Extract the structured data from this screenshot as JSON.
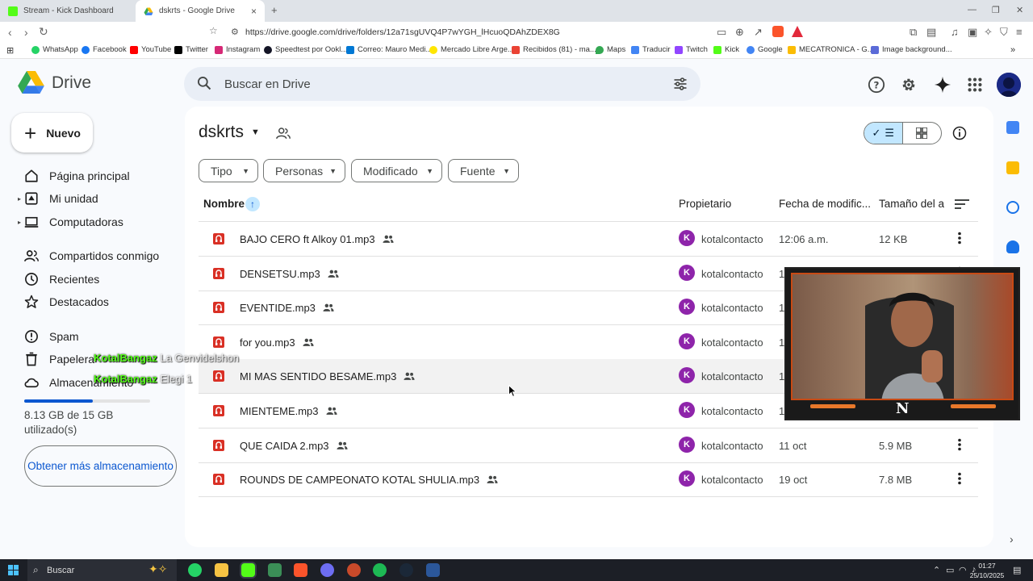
{
  "browser": {
    "tabs": [
      {
        "title": "Stream - Kick Dashboard",
        "active": false
      },
      {
        "title": "dskrts - Google Drive",
        "active": true
      }
    ],
    "url": "https://drive.google.com/drive/folders/12a71sgUVQ4P7wYGH_lHcuoQDAhZDEX8G",
    "bookmarks": [
      "WhatsApp",
      "Facebook",
      "YouTube",
      "Twitter",
      "Instagram",
      "Speedtest por Ookl...",
      "Correo: Mauro Medi...",
      "Mercado Libre Arge...",
      "Recibidos (81) - ma...",
      "Maps",
      "Traducir",
      "Twitch",
      "Kick",
      "Google",
      "MECATRONICA - G...",
      "Image background..."
    ]
  },
  "drive": {
    "logo_text": "Drive",
    "search_placeholder": "Buscar en Drive",
    "new_button": "Nuevo",
    "nav": {
      "home": "Página principal",
      "my_drive": "Mi unidad",
      "computers": "Computadoras",
      "shared": "Compartidos conmigo",
      "recent": "Recientes",
      "starred": "Destacados",
      "spam": "Spam",
      "trash": "Papelera",
      "storage": "Almacenamiento"
    },
    "storage": {
      "used_fraction": 0.542,
      "text": "8.13 GB de 15 GB utilizado(s)",
      "button": "Obtener más almacenamiento"
    },
    "folder_title": "dskrts",
    "filters": [
      "Tipo",
      "Personas",
      "Modificado",
      "Fuente"
    ],
    "columns": {
      "name": "Nombre",
      "owner": "Propietario",
      "modified": "Fecha de modific...",
      "size": "Tamaño del a"
    },
    "files": [
      {
        "name": "BAJO CERO ft Alkoy 01.mp3",
        "owner": "kotalcontacto",
        "owner_initial": "K",
        "modified": "12:06 a.m.",
        "size": "12 KB"
      },
      {
        "name": "DENSETSU.mp3",
        "owner": "kotalcontacto",
        "owner_initial": "K",
        "modified": "1",
        "size": ""
      },
      {
        "name": "EVENTIDE.mp3",
        "owner": "kotalcontacto",
        "owner_initial": "K",
        "modified": "1",
        "size": ""
      },
      {
        "name": "for you.mp3",
        "owner": "kotalcontacto",
        "owner_initial": "K",
        "modified": "1",
        "size": ""
      },
      {
        "name": "MI MAS SENTIDO BESAME.mp3",
        "owner": "kotalcontacto",
        "owner_initial": "K",
        "modified": "1",
        "size": ""
      },
      {
        "name": "MIENTEME.mp3",
        "owner": "kotalcontacto",
        "owner_initial": "K",
        "modified": "1",
        "size": ""
      },
      {
        "name": "QUE CAIDA 2.mp3",
        "owner": "kotalcontacto",
        "owner_initial": "K",
        "modified": "11 oct",
        "size": "5.9 MB"
      },
      {
        "name": "ROUNDS DE CAMPEONATO KOTAL SHULIA.mp3",
        "owner": "kotalcontacto",
        "owner_initial": "K",
        "modified": "19 oct",
        "size": "7.8 MB"
      }
    ]
  },
  "overlay_chat": [
    {
      "user": "KotalBangaz",
      "msg": "La Genvidelshon"
    },
    {
      "user": "KotalBangaz",
      "msg": "Elegi 1"
    }
  ],
  "taskbar": {
    "search": "Buscar",
    "time": "01:27",
    "date": "25/10/2025"
  },
  "colors": {
    "accent": "#0b57d0",
    "selected": "#c2e7ff",
    "audio_icon": "#d93025",
    "owner_avatar": "#8e24aa",
    "chat_user": "#53fc18"
  }
}
